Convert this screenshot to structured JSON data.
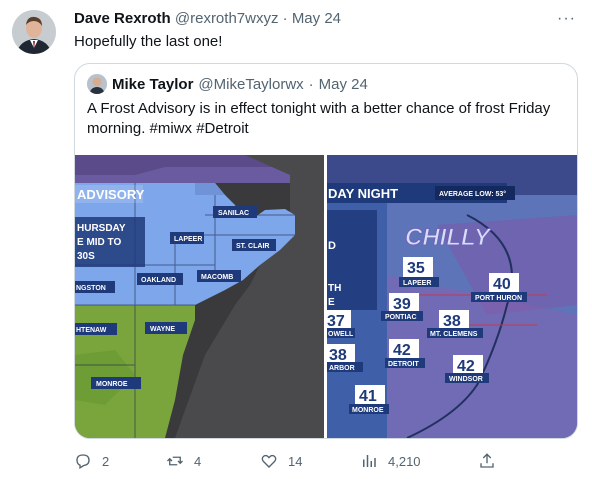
{
  "tweet": {
    "author_name": "Dave Rexroth",
    "author_handle": "@rexroth7wxyz",
    "separator": "·",
    "date": "May 24",
    "text": "Hopefully the last one!",
    "more_label": "···"
  },
  "quoted": {
    "author_name": "Mike Taylor",
    "author_handle": "@MikeTaylorwx",
    "separator": "·",
    "date": "May 24",
    "text": "A Frost Advisory is in effect tonight with a better chance of frost Friday morning. #miwx #Detroit"
  },
  "map_left": {
    "banner": "ADVISORY",
    "info_line1": "HURSDAY",
    "info_line2": "E MID TO",
    "info_line3": "30S",
    "counties": [
      "SANILAC",
      "LAPEER",
      "ST. CLAIR",
      "OAKLAND",
      "MACOMB",
      "NGSTON",
      "HTENAW",
      "WAYNE",
      "MONROE"
    ]
  },
  "map_right": {
    "banner": "DAY NIGHT",
    "average_low": "AVERAGE LOW: 53°",
    "badge": "CHILLY",
    "side_text1": "D",
    "side_text2": "TH",
    "side_text3": "E",
    "temps": [
      {
        "value": "35",
        "city": "LAPEER"
      },
      {
        "value": "40",
        "city": "PORT HURON"
      },
      {
        "value": "39",
        "city": "PONTIAC"
      },
      {
        "value": "38",
        "city": "MT. CLEMENS"
      },
      {
        "value": "37",
        "city": "OWELL"
      },
      {
        "value": "38",
        "city": "ARBOR"
      },
      {
        "value": "42",
        "city": "DETROIT"
      },
      {
        "value": "42",
        "city": "WINDSOR"
      },
      {
        "value": "41",
        "city": "MONROE"
      }
    ]
  },
  "actions": {
    "replies": "2",
    "retweets": "4",
    "likes": "14",
    "views": "4,210"
  },
  "colors": {
    "advisory_blue": "#7ea6ea",
    "banner_navy": "#1e3a7a",
    "chilly_purple": "#7d72c8"
  }
}
